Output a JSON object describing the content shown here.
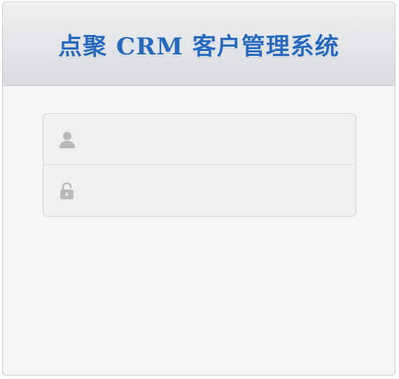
{
  "app": {
    "title": "点聚 CRM 客户管理系统"
  },
  "login": {
    "username": {
      "icon": "user-icon",
      "value": "",
      "placeholder": ""
    },
    "password": {
      "icon": "lock-icon",
      "value": "",
      "placeholder": ""
    }
  },
  "colors": {
    "title": "#2669bd",
    "header_top": "#eef0f3",
    "header_bottom": "#d8dbe0",
    "panel_bg": "#f4f5f7",
    "field_bg": "#f0f0f0",
    "icon": "#b9b9b9"
  }
}
